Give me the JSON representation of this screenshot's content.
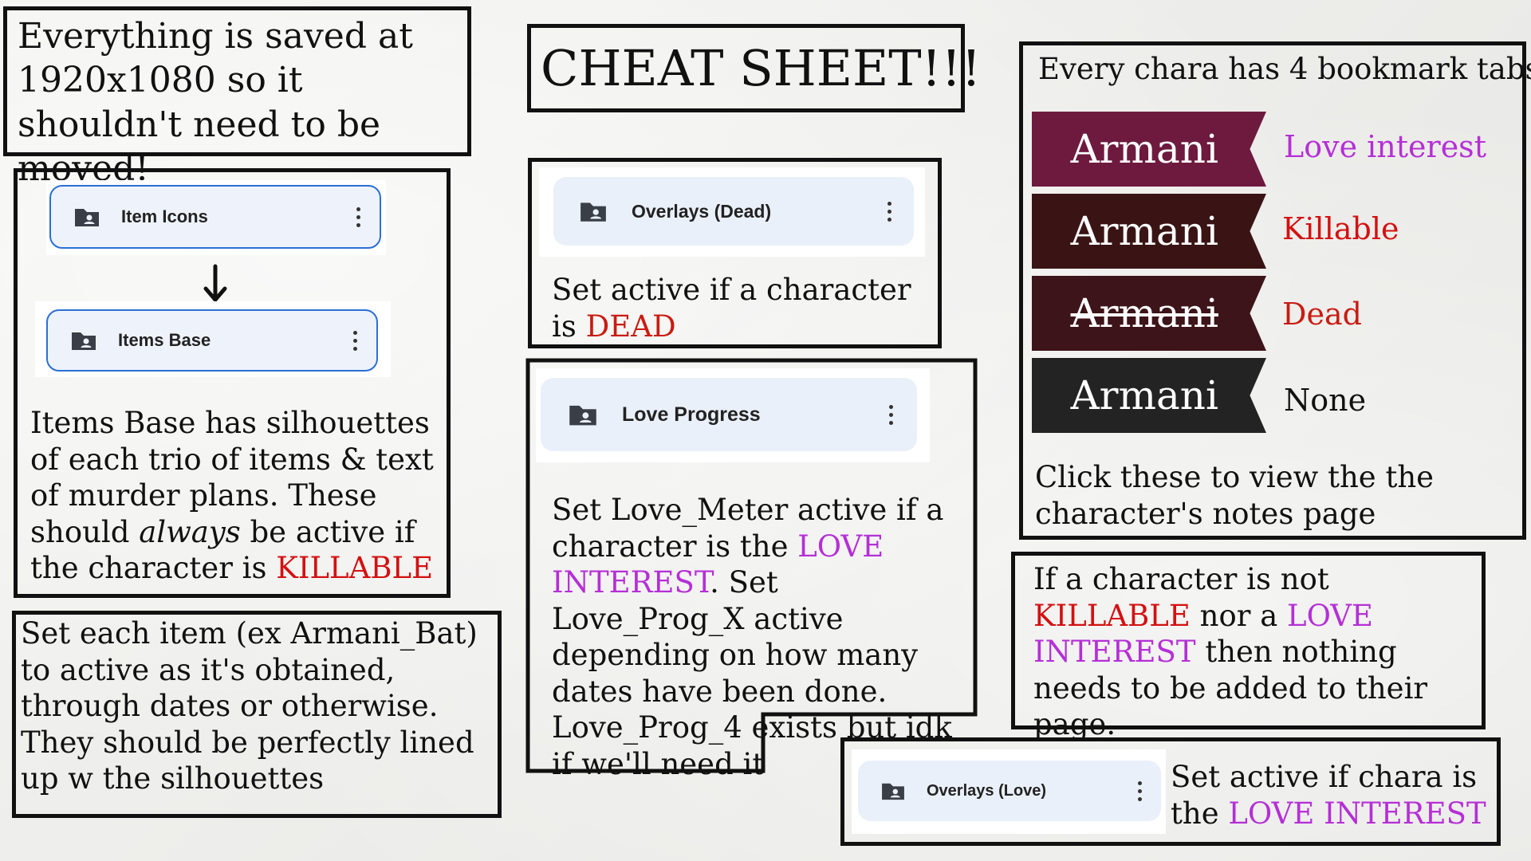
{
  "notes": {
    "saved": "Everything is saved at 1920x1080 so it shouldn't need to be moved!",
    "title": "CHEAT SHEET!!!",
    "items_base_pre": "Items Base has silhouettes of each trio of items & text of murder plans. These should ",
    "items_base_em": "always",
    "items_base_mid": " be active if the character is ",
    "items_base_key": "KILLABLE",
    "set_items": "Set each item (ex Armani_Bat) to active as it's obtained, through dates or otherwise. They should be perfectly lined up w the silhouettes",
    "dead_pre": "Set active if a character is ",
    "dead_key": "DEAD",
    "love_pre": "Set Love_Meter active if a character is the ",
    "love_key": "LOVE INTEREST",
    "love_post": ". Set Love_Prog_X active depending on how many dates have been done. Love_Prog_4 exists but idk if we'll need it",
    "tabs_header": "Every chara has 4 bookmark tabs",
    "tabs_click": "Click these to view the the character's notes page",
    "none_pre": "If a character is not ",
    "none_key1": "KILLABLE",
    "none_mid": " nor a ",
    "none_key2": "LOVE INTEREST",
    "none_post": " then nothing needs to be added to their page.",
    "ol_pre": "Set active if chara is the ",
    "ol_key": "LOVE INTEREST"
  },
  "chips": {
    "item_icons": "Item Icons",
    "items_base": "Items Base",
    "overlays_dead": "Overlays (Dead)",
    "love_progress": "Love Progress",
    "overlays_love": "Overlays (Love)"
  },
  "tabs": [
    {
      "name": "Armani",
      "label": "Love interest",
      "color": "#6e1a3f",
      "label_color": "#b52fd6"
    },
    {
      "name": "Armani",
      "label": "Killable",
      "color": "#3a1414",
      "label_color": "#d41010"
    },
    {
      "name": "Armani",
      "label": "Dead",
      "color": "#3d1419",
      "label_color": "#c91c12"
    },
    {
      "name": "Armani",
      "label": "None",
      "color": "#232323",
      "label_color": "#111111"
    }
  ],
  "icons": [
    "folder-shared-icon",
    "more-vert-icon",
    "down-arrow-icon"
  ]
}
